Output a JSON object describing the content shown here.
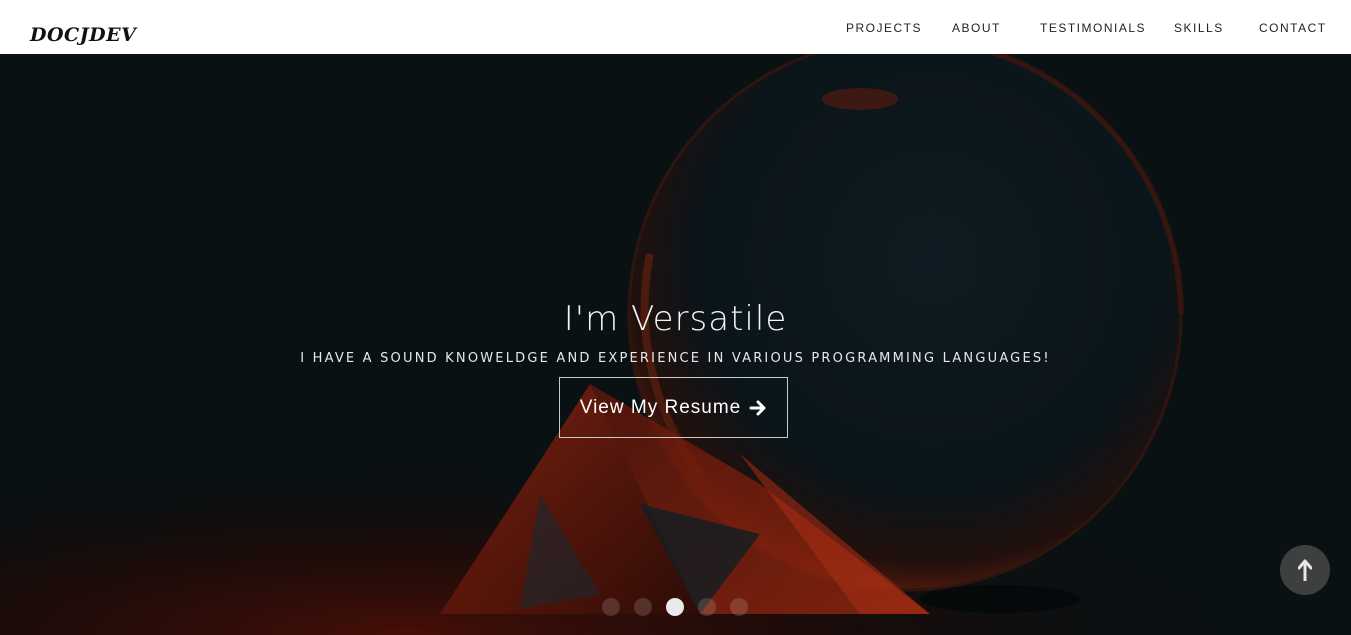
{
  "navbar": {
    "brand": "DOCJDEV",
    "items": [
      "PROJECTS",
      "ABOUT",
      "TESTIMONIALS",
      "SKILLS",
      "CONTACT"
    ]
  },
  "hero": {
    "heading": "I'm Versatile",
    "subheading": "I HAVE A SOUND KNOWELDGE AND EXPERIENCE IN VARIOUS PROGRAMMING LANGUAGES!",
    "cta_label": "View My Resume"
  },
  "carousel": {
    "slide_count": 5,
    "active_index": 3
  },
  "icons": {
    "cta": "arrow-right-icon",
    "back_to_top": "arrow-up-icon"
  },
  "colors": {
    "nav_bg": "#ffffff",
    "hero_dark": "#0b1518",
    "accent_red": "#a52a14"
  }
}
